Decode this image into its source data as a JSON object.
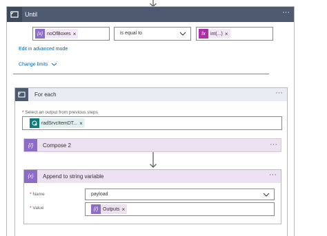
{
  "until": {
    "title": "Until",
    "menu": "···",
    "condition": {
      "left_token": {
        "icon": "{x}",
        "label": "noOfBoxes",
        "remove": "×"
      },
      "operator": "is equal to",
      "right_token": {
        "icon": "fx",
        "label": "int(...)",
        "remove": "×"
      }
    },
    "advanced_link": "Edit in advanced mode",
    "limits_link": "Change limits"
  },
  "foreach": {
    "title": "For each",
    "menu": "···",
    "output_label_req": "*",
    "output_label": "Select an output from previous steps",
    "output_token": {
      "label": "radSrvcItemDT...",
      "remove": "×"
    }
  },
  "compose": {
    "title": "Compose 2",
    "icon": "{/}",
    "menu": "···"
  },
  "append": {
    "title": "Append to string variable",
    "icon": "{x}",
    "menu": "···",
    "name_label": "Name",
    "name_value": "payload",
    "value_label": "Value",
    "value_token": {
      "icon": "{/}",
      "label": "Outputs",
      "remove": "×"
    },
    "req": "*"
  },
  "colors": {
    "header_dark": "#4d5a6f",
    "variable_purple": "#8c6cc8",
    "expression_pink": "#ad2fa8",
    "link_blue": "#0062ad",
    "teal": "#0f7b7b"
  }
}
